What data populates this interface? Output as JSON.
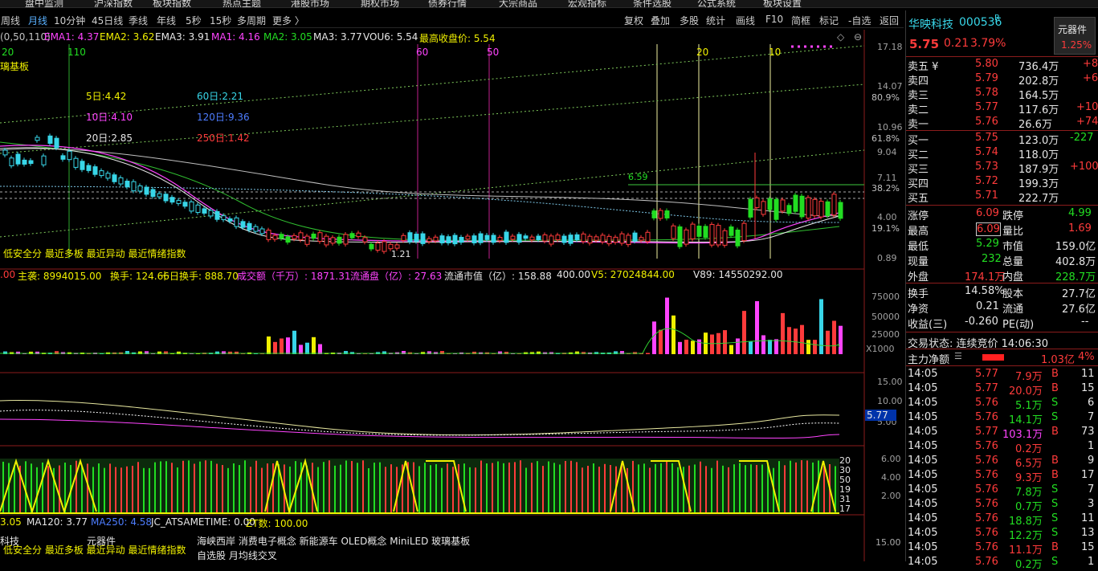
{
  "top_menu": [
    "盘中监测",
    "沪深指数",
    "板块指数",
    "热点主题",
    "港股市场",
    "期权市场",
    "债券行情",
    "大宗商品",
    "宏观指标",
    "条件选股",
    "公式系统",
    "板块设置"
  ],
  "periods": [
    {
      "label": "周线",
      "active": false
    },
    {
      "label": "月线",
      "active": true
    },
    {
      "label": "10分钟",
      "active": false
    },
    {
      "label": "45日线",
      "active": false
    },
    {
      "label": "季线",
      "active": false
    },
    {
      "label": "年线",
      "active": false
    },
    {
      "label": "5秒",
      "active": false
    },
    {
      "label": "15秒",
      "active": false
    },
    {
      "label": "多周期",
      "active": false
    },
    {
      "label": "更多 〉",
      "active": false
    }
  ],
  "toolbar": [
    "复权",
    "叠加",
    "多股",
    "统计",
    "画线",
    "F10",
    "简框",
    "标记",
    "-自选",
    "返回"
  ],
  "indicator_line": {
    "prefix": "(0,50,110)",
    "ema1": "EMA1: 4.37",
    "ema2": "EMA2: 3.62",
    "ema3": "EMA3: 3.91",
    "ma1": "MA1: 4.16",
    "ma2": "MA2: 3.05",
    "ma3": "MA3: 3.77",
    "vou": "VOU6: 5.54",
    "high": "最高收盘价: 5.54"
  },
  "left_labels": {
    "n20": "20",
    "board": "璃基板",
    "n110": "110"
  },
  "ma_legend": {
    "d5": "5日:4.42",
    "d60": "60日:2.21",
    "d10": "10日:4.10",
    "d120": "120日:9.36",
    "d20": "20日:2.85",
    "d250": "250日:1.42"
  },
  "vertical_labels": {
    "v60": "60",
    "v50": "50",
    "v20": "20",
    "v10": "10"
  },
  "price_labels": {
    "p659": "6.59",
    "p121": "1.21"
  },
  "bottom_tags": "低安全分  最近多板  最近异动  最近情绪指数",
  "price_axis": [
    "17.18",
    "14.07",
    "80.9%",
    "10.96",
    "61.8%",
    "9.04",
    "7.11",
    "38.2%",
    "4.00",
    "19.1%",
    "0.89"
  ],
  "volume_info": {
    "prefix": ".00",
    "main": "主袭: 8994015.00",
    "turnover": "换手: 124.66",
    "ten_turnover": "十日换手: 888.70",
    "amount": "成交额（千万）: 1871.31",
    "float_cap": "流通盘（亿）: 27.63",
    "float_val": "流通市值（亿）: 158.88",
    "val400": "400.00",
    "v5": "V5: 27024844.00",
    "v89": "V89: 14550292.00"
  },
  "volume_axis": [
    "75000",
    "50000",
    "25000",
    "X1000"
  ],
  "osc_axis": [
    "15.00",
    "10.00",
    "5.00"
  ],
  "osc_current": "5.77",
  "signal_axis": [
    "6.00",
    "4.00",
    "2.00"
  ],
  "signal_side": [
    "20",
    "30",
    "50",
    "19",
    "31",
    "17"
  ],
  "bottom_info": {
    "ma_a": "3.05",
    "ma120": "MA120: 3.77",
    "ma250": "MA250: 4.58",
    "jc": "JC_ATSAMETIME: 0.00",
    "zt": "ZT数: 100.00"
  },
  "bottom_axis": "15.00",
  "bottom_left": {
    "tech": "科技",
    "comp": "元器件"
  },
  "concepts": "海峡西岸  消费电子概念  新能源车  OLED概念  MiniLED  玻璃基板",
  "concepts2": "自选股  月均线交叉",
  "stock": {
    "name": "华映科技",
    "code": "000536",
    "r": "R",
    "industry": "元器件",
    "industry_pct": "1.25%",
    "price": "5.75",
    "change": "0.21",
    "pct": "3.79%"
  },
  "order_book": {
    "sells": [
      {
        "label": "卖五 ¥",
        "price": "5.80",
        "vol": "736.4万",
        "delta": "+8"
      },
      {
        "label": "卖四",
        "price": "5.79",
        "vol": "202.8万",
        "delta": "+6"
      },
      {
        "label": "卖三",
        "price": "5.78",
        "vol": "164.5万",
        "delta": ""
      },
      {
        "label": "卖二",
        "price": "5.77",
        "vol": "117.6万",
        "delta": "+10"
      },
      {
        "label": "卖一",
        "price": "5.76",
        "vol": "26.6万",
        "delta": "+74"
      }
    ],
    "buys": [
      {
        "label": "买一",
        "price": "5.75",
        "vol": "123.0万",
        "delta": "-227"
      },
      {
        "label": "买二",
        "price": "5.74",
        "vol": "118.0万",
        "delta": ""
      },
      {
        "label": "买三",
        "price": "5.73",
        "vol": "187.9万",
        "delta": "+100"
      },
      {
        "label": "买四",
        "price": "5.72",
        "vol": "199.3万",
        "delta": ""
      },
      {
        "label": "买五",
        "price": "5.71",
        "vol": "222.7万",
        "delta": ""
      }
    ]
  },
  "stats": [
    {
      "l1": "涨停",
      "v1": "6.09",
      "l2": "跌停",
      "v2": "4.99"
    },
    {
      "l1": "最高",
      "v1": "6.09",
      "l2": "量比",
      "v2": "1.69"
    },
    {
      "l1": "最低",
      "v1": "5.29",
      "l2": "市值",
      "v2": "159.0亿"
    },
    {
      "l1": "现量",
      "v1": "232",
      "l2": "总量",
      "v2": "402.8万"
    },
    {
      "l1": "外盘",
      "v1": "174.1万",
      "l2": "内盘",
      "v2": "228.7万"
    }
  ],
  "stats2": [
    {
      "l1": "换手",
      "v1": "14.58%",
      "l2": "股本",
      "v2": "27.7亿"
    },
    {
      "l1": "净资",
      "v1": "0.21",
      "l2": "流通",
      "v2": "27.6亿"
    },
    {
      "l1": "收益(三)",
      "v1": "-0.260",
      "l2": "PE(动)",
      "v2": "--"
    }
  ],
  "trade_status": "交易状态: 连续竞价 14:06:30",
  "main_flow": {
    "label": "主力净额",
    "value": "1.03亿",
    "pct": "4%"
  },
  "ticks": [
    {
      "t": "14:05",
      "p": "5.77",
      "v": "7.9万",
      "s": "B",
      "n": "11"
    },
    {
      "t": "14:05",
      "p": "5.77",
      "v": "20.0万",
      "s": "B",
      "n": "15"
    },
    {
      "t": "14:05",
      "p": "5.76",
      "v": "5.1万",
      "s": "S",
      "n": "6"
    },
    {
      "t": "14:05",
      "p": "5.76",
      "v": "14.1万",
      "s": "S",
      "n": "7"
    },
    {
      "t": "14:05",
      "p": "5.77",
      "v": "103.1万",
      "s": "B",
      "n": "73"
    },
    {
      "t": "14:05",
      "p": "5.76",
      "v": "0.2万",
      "s": "",
      "n": "1"
    },
    {
      "t": "14:05",
      "p": "5.76",
      "v": "6.5万",
      "s": "B",
      "n": "9"
    },
    {
      "t": "14:05",
      "p": "5.76",
      "v": "9.3万",
      "s": "B",
      "n": "17"
    },
    {
      "t": "14:05",
      "p": "5.76",
      "v": "7.8万",
      "s": "S",
      "n": "7"
    },
    {
      "t": "14:05",
      "p": "5.76",
      "v": "0.7万",
      "s": "S",
      "n": "3"
    },
    {
      "t": "14:05",
      "p": "5.76",
      "v": "18.8万",
      "s": "S",
      "n": "11"
    },
    {
      "t": "14:05",
      "p": "5.76",
      "v": "12.2万",
      "s": "S",
      "n": "13"
    },
    {
      "t": "14:05",
      "p": "5.76",
      "v": "11.1万",
      "s": "B",
      "n": "15"
    },
    {
      "t": "14:05",
      "p": "5.76",
      "v": "0.2万",
      "s": "S",
      "n": "1"
    }
  ],
  "colors": {
    "up": "#ff3b3b",
    "down": "#22dd22",
    "cyan": "#38d6e8",
    "yellow": "#f0f000",
    "magenta": "#ff44ff"
  }
}
